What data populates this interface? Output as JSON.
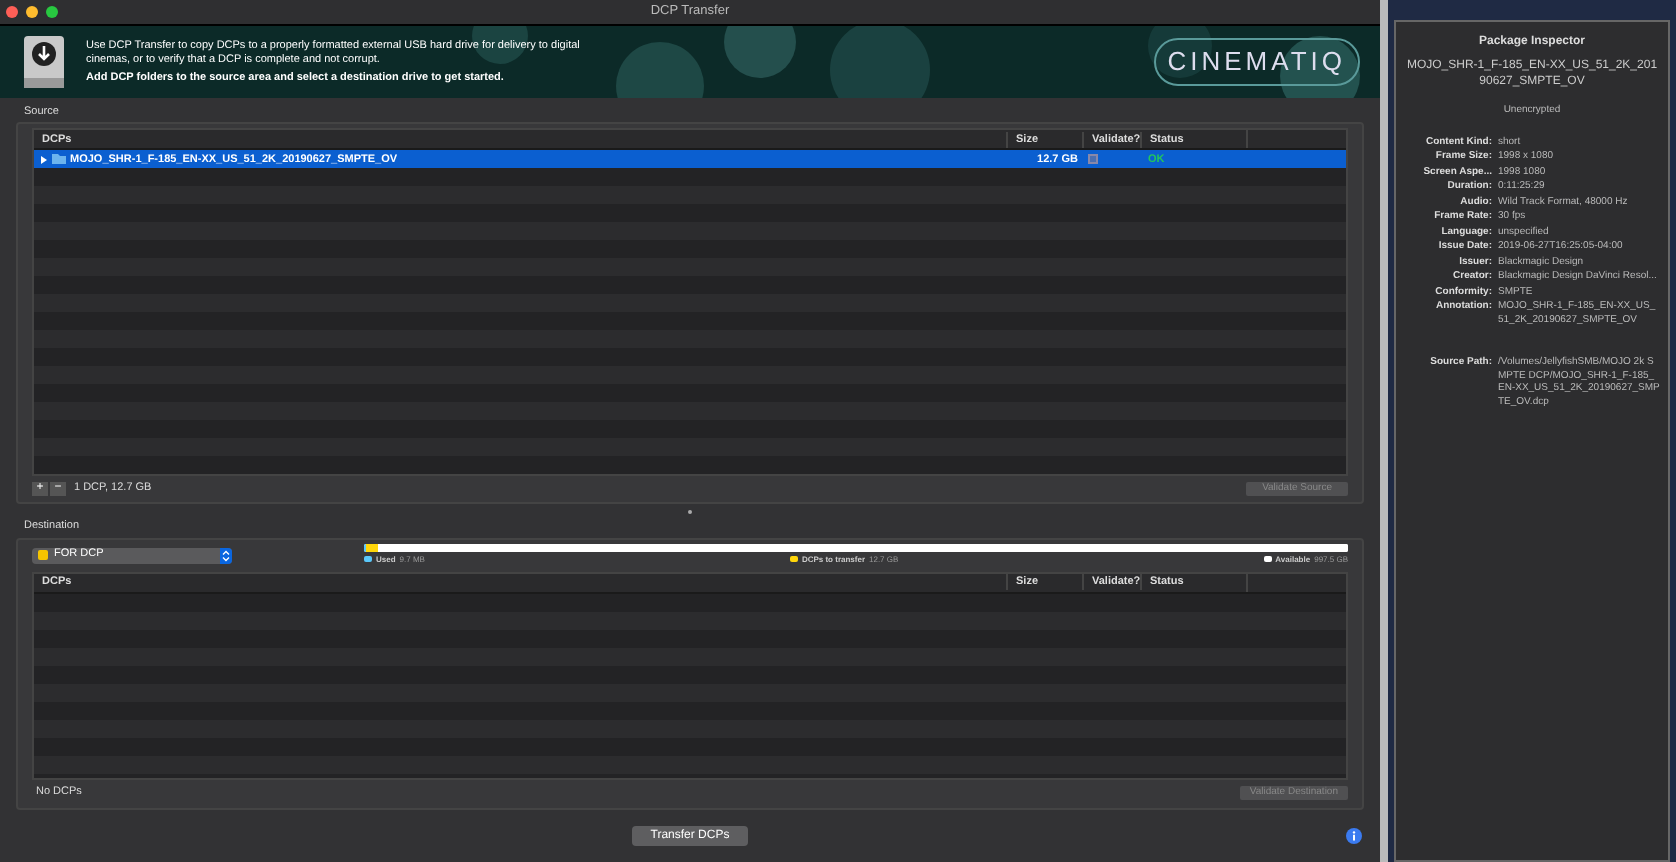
{
  "window": {
    "title": "DCP Transfer"
  },
  "banner": {
    "text": "Use DCP Transfer to copy DCPs to a properly formatted external USB hard drive for delivery to digital cinemas, or to verify that a DCP is complete and not corrupt.",
    "hint": "Add DCP folders to the source area and select a destination drive to get started.",
    "logo": "CINEMATIQ"
  },
  "source": {
    "label": "Source",
    "columns": [
      "DCPs",
      "Size",
      "Validate?",
      "Status"
    ],
    "rows": [
      {
        "name": "MOJO_SHR-1_F-185_EN-XX_US_51_2K_20190627_SMPTE_OV",
        "size": "12.7 GB",
        "validate": false,
        "status": "OK",
        "selected": true,
        "expanded": false
      }
    ],
    "add": "+",
    "remove": "−",
    "summary": "1 DCP, 12.7 GB",
    "validate_button": "Validate Source"
  },
  "destination": {
    "label": "Destination",
    "drive": "FOR DCP",
    "usage": [
      {
        "label": "Used",
        "value": "9.7 MB",
        "level": 0.002,
        "color": "#5ac8fa"
      },
      {
        "label": "DCPs to transfer",
        "value": "12.7 GB",
        "level": 0.012,
        "color": "#ffd60a"
      },
      {
        "label": "Available",
        "value": "997.5 GB",
        "level": 0.986,
        "color": "#ffffff"
      }
    ],
    "columns": [
      "DCPs",
      "Size",
      "Validate?",
      "Status"
    ],
    "summary": "No DCPs",
    "validate_button": "Validate Destination"
  },
  "transfer_button": "Transfer DCPs",
  "inspector": {
    "title": "Package Inspector",
    "package": "MOJO_SHR-1_F-185_EN-XX_US_51_2K_20190627_SMPTE_OV",
    "encryption": "Unencrypted",
    "fields": [
      {
        "label": "Content Kind:",
        "value": "short"
      },
      {
        "label": "Frame Size:",
        "value": "1998 x 1080"
      },
      {
        "label": "Screen Aspe...",
        "value": "1998 1080"
      },
      {
        "label": "Duration:",
        "value": "0:11:25:29"
      },
      {
        "label": "Audio:",
        "value": "Wild Track Format, 48000 Hz"
      },
      {
        "label": "Frame Rate:",
        "value": "30 fps"
      },
      {
        "label": "Language:",
        "value": "unspecified"
      },
      {
        "label": "Issue Date:",
        "value": "2019-06-27T16:25:05-04:00"
      },
      {
        "label": "Issuer:",
        "value": "Blackmagic Design"
      },
      {
        "label": "Creator:",
        "value": "Blackmagic Design DaVinci Resol..."
      },
      {
        "label": "Conformity:",
        "value": "SMPTE"
      },
      {
        "label": "Annotation:",
        "value": "MOJO_SHR-1_F-185_EN-XX_US_51_2K_20190627_SMPTE_OV"
      }
    ],
    "source_path": {
      "label": "Source Path:",
      "value": "/Volumes/JellyfishSMB/MOJO 2k SMPTE DCP/MOJO_SHR-1_F-185_EN-XX_US_51_2K_20190627_SMPTE_OV.dcp"
    }
  }
}
